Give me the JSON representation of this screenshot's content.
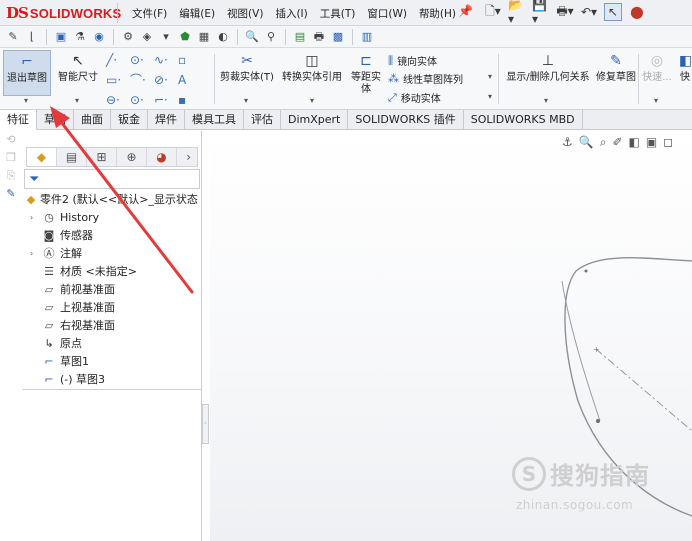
{
  "app": {
    "logo_ds": "DS",
    "logo_text": "SOLIDWORKS"
  },
  "menu": [
    "文件(F)",
    "编辑(E)",
    "视图(V)",
    "插入(I)",
    "工具(T)",
    "窗口(W)",
    "帮助(H)"
  ],
  "quick_access_icons": [
    "new-document-icon",
    "open-icon",
    "save-icon",
    "print-icon",
    "undo-icon",
    "select-pointer-icon",
    "traffic-light-icon"
  ],
  "command_manager": {
    "exit_sketch": "退出草图",
    "smart_dimension": "智能尺寸",
    "trim_entities": "剪裁实体(T)",
    "convert_entities": "转换实体引用",
    "offset_entities": "等距实体",
    "mirror_entities": "镜向实体",
    "linear_pattern": "线性草图阵列",
    "move_entities": "移动实体",
    "display_relations": "显示/删除几何关系",
    "repair_sketch": "修复草图",
    "quick_snaps": "快速...",
    "cut_label": "快"
  },
  "tabs": [
    "特征",
    "草图",
    "曲面",
    "钣金",
    "焊件",
    "模具工具",
    "评估",
    "DimXpert",
    "SOLIDWORKS 插件",
    "SOLIDWORKS MBD"
  ],
  "feature_tree": {
    "root": "零件2 (默认<<默认>_显示状态",
    "items": [
      {
        "label": "History",
        "icon": "history-icon",
        "expandable": true
      },
      {
        "label": "传感器",
        "icon": "sensor-icon",
        "expandable": false
      },
      {
        "label": "注解",
        "icon": "annotation-icon",
        "expandable": true
      },
      {
        "label": "材质 <未指定>",
        "icon": "material-icon",
        "expandable": false
      },
      {
        "label": "前视基准面",
        "icon": "plane-icon",
        "expandable": false
      },
      {
        "label": "上视基准面",
        "icon": "plane-icon",
        "expandable": false
      },
      {
        "label": "右视基准面",
        "icon": "plane-icon",
        "expandable": false
      },
      {
        "label": "原点",
        "icon": "origin-icon",
        "expandable": false
      },
      {
        "label": "草图1",
        "icon": "sketch-icon",
        "expandable": false
      },
      {
        "label": "(-) 草图3",
        "icon": "sketch-icon",
        "expandable": false
      }
    ]
  },
  "watermark": {
    "logo_char": "S",
    "text": "搜狗指南",
    "url": "zhinan.sogou.com"
  },
  "colors": {
    "brand_red": "#d71920",
    "accent_blue": "#2d62b3",
    "annotation_arrow": "#e23b3b"
  }
}
